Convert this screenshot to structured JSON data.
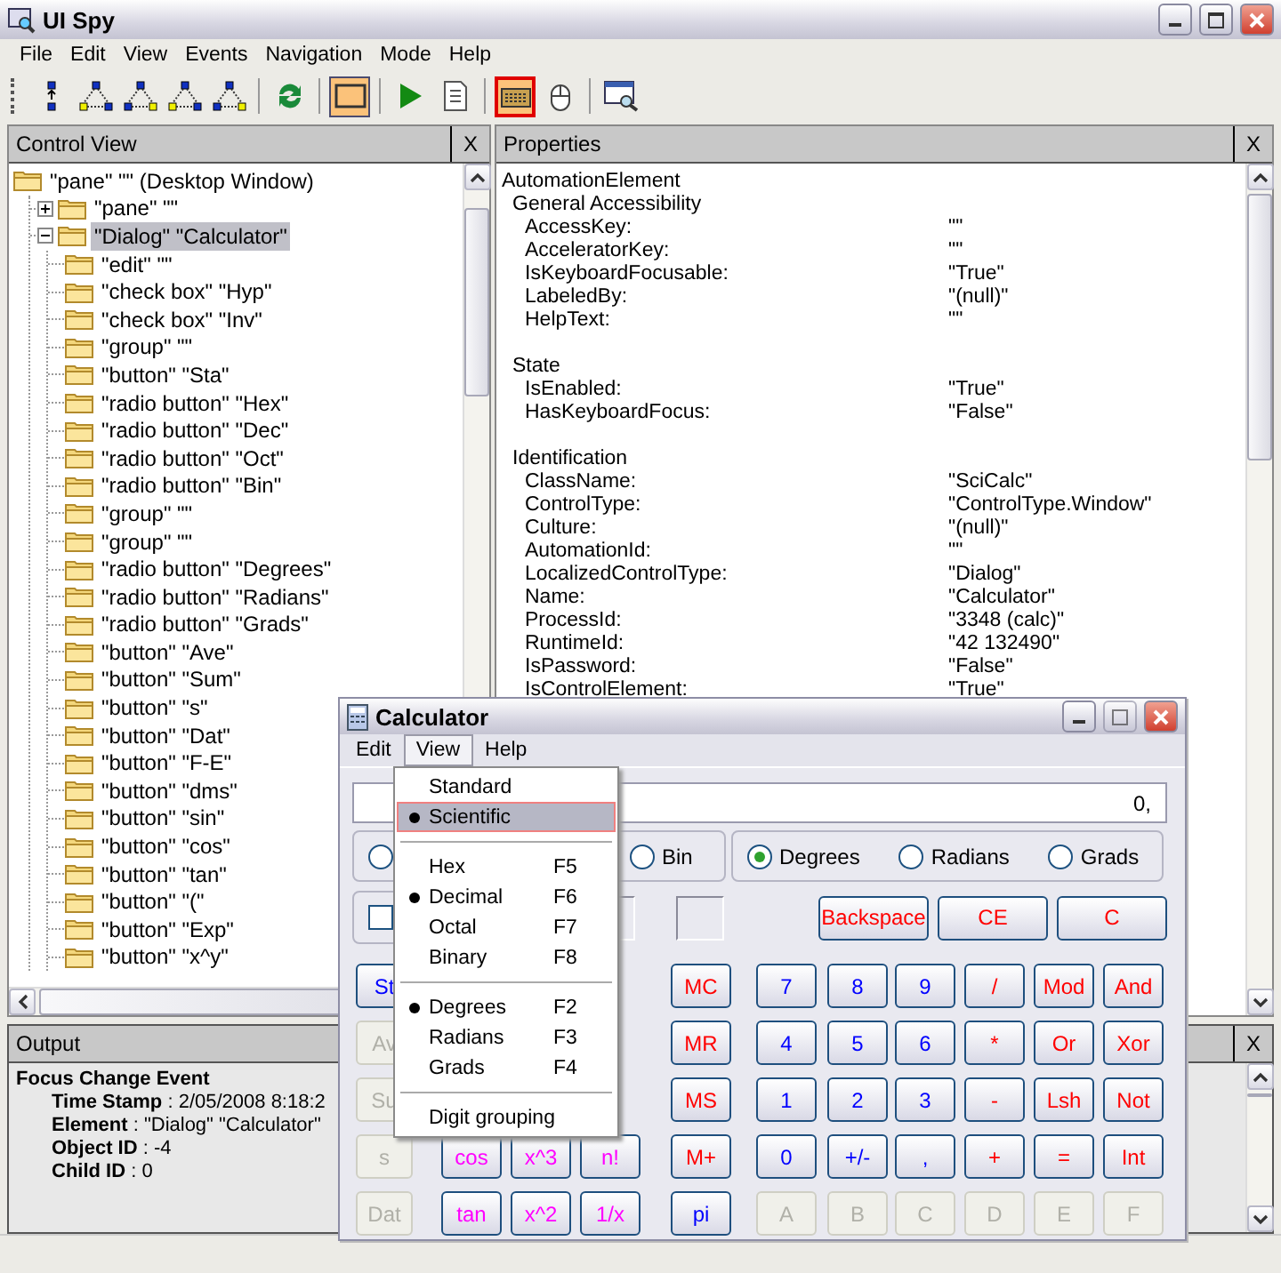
{
  "window": {
    "title": "UI Spy"
  },
  "menu": [
    {
      "label": "File"
    },
    {
      "label": "Edit"
    },
    {
      "label": "View"
    },
    {
      "label": "Events"
    },
    {
      "label": "Navigation"
    },
    {
      "label": "Mode"
    },
    {
      "label": "Help"
    }
  ],
  "toolbar": [
    {
      "kind": "parent",
      "pressed": false,
      "highlighted": false
    },
    {
      "kind": "first-child",
      "pressed": false,
      "highlighted": false
    },
    {
      "kind": "next-sibling",
      "pressed": false,
      "highlighted": false
    },
    {
      "kind": "previous-sibling",
      "pressed": false,
      "highlighted": false
    },
    {
      "kind": "last-child",
      "pressed": false,
      "highlighted": false
    },
    {
      "kind": "separator"
    },
    {
      "kind": "refresh",
      "pressed": false,
      "highlighted": false
    },
    {
      "kind": "separator"
    },
    {
      "kind": "highlight",
      "pressed": true,
      "highlighted": false
    },
    {
      "kind": "separator"
    },
    {
      "kind": "play",
      "pressed": false,
      "highlighted": false
    },
    {
      "kind": "list",
      "pressed": false,
      "highlighted": false
    },
    {
      "kind": "separator"
    },
    {
      "kind": "keyboard",
      "pressed": true,
      "highlighted": true
    },
    {
      "kind": "mouse",
      "pressed": false,
      "highlighted": false
    },
    {
      "kind": "separator"
    },
    {
      "kind": "inspect",
      "pressed": false,
      "highlighted": false
    }
  ],
  "control_view": {
    "title": "Control View",
    "close": "X",
    "tree": [
      {
        "label": "\"pane\" \"\" (Desktop Window)",
        "selected": false,
        "children": [
          {
            "label": "\"pane\" \"\"",
            "selected": false,
            "expanded": false
          },
          {
            "label": "\"Dialog\" \"Calculator\"",
            "selected": true,
            "expanded": true,
            "children": [
              {
                "label": "\"edit\" \"\"",
                "selected": false
              },
              {
                "label": "\"check box\" \"Hyp\"",
                "selected": false
              },
              {
                "label": "\"check box\" \"Inv\"",
                "selected": false
              },
              {
                "label": "\"group\" \"\"",
                "selected": false
              },
              {
                "label": "\"button\" \"Sta\"",
                "selected": false
              },
              {
                "label": "\"radio button\" \"Hex\"",
                "selected": false
              },
              {
                "label": "\"radio button\" \"Dec\"",
                "selected": false
              },
              {
                "label": "\"radio button\" \"Oct\"",
                "selected": false
              },
              {
                "label": "\"radio button\" \"Bin\"",
                "selected": false
              },
              {
                "label": "\"group\" \"\"",
                "selected": false
              },
              {
                "label": "\"group\" \"\"",
                "selected": false
              },
              {
                "label": "\"radio button\" \"Degrees\"",
                "selected": false
              },
              {
                "label": "\"radio button\" \"Radians\"",
                "selected": false
              },
              {
                "label": "\"radio button\" \"Grads\"",
                "selected": false
              },
              {
                "label": "\"button\" \"Ave\"",
                "selected": false
              },
              {
                "label": "\"button\" \"Sum\"",
                "selected": false
              },
              {
                "label": "\"button\" \"s\"",
                "selected": false
              },
              {
                "label": "\"button\" \"Dat\"",
                "selected": false
              },
              {
                "label": "\"button\" \"F-E\"",
                "selected": false
              },
              {
                "label": "\"button\" \"dms\"",
                "selected": false
              },
              {
                "label": "\"button\" \"sin\"",
                "selected": false
              },
              {
                "label": "\"button\" \"cos\"",
                "selected": false
              },
              {
                "label": "\"button\" \"tan\"",
                "selected": false
              },
              {
                "label": "\"button\" \"(\"",
                "selected": false
              },
              {
                "label": "\"button\" \"Exp\"",
                "selected": false
              },
              {
                "label": "\"button\" \"x^y\"",
                "selected": false
              }
            ]
          }
        ]
      }
    ]
  },
  "properties": {
    "title": "Properties",
    "close": "X",
    "root": "AutomationElement",
    "groups": [
      {
        "title": "General Accessibility",
        "rows": [
          {
            "name": "AccessKey:",
            "value": "\"\""
          },
          {
            "name": "AcceleratorKey:",
            "value": "\"\""
          },
          {
            "name": "IsKeyboardFocusable:",
            "value": "\"True\""
          },
          {
            "name": "LabeledBy:",
            "value": "\"(null)\""
          },
          {
            "name": "HelpText:",
            "value": "\"\""
          }
        ]
      },
      {
        "title": "State",
        "rows": [
          {
            "name": "IsEnabled:",
            "value": "\"True\""
          },
          {
            "name": "HasKeyboardFocus:",
            "value": "\"False\""
          }
        ]
      },
      {
        "title": "Identification",
        "rows": [
          {
            "name": "ClassName:",
            "value": "\"SciCalc\""
          },
          {
            "name": "ControlType:",
            "value": "\"ControlType.Window\""
          },
          {
            "name": "Culture:",
            "value": "\"(null)\""
          },
          {
            "name": "AutomationId:",
            "value": "\"\""
          },
          {
            "name": "LocalizedControlType:",
            "value": "\"Dialog\""
          },
          {
            "name": "Name:",
            "value": "\"Calculator\""
          },
          {
            "name": "ProcessId:",
            "value": "\"3348 (calc)\""
          },
          {
            "name": "RuntimeId:",
            "value": "\"42 132490\""
          },
          {
            "name": "IsPassword:",
            "value": "\"False\""
          },
          {
            "name": "IsControlElement:",
            "value": "\"True\""
          }
        ]
      }
    ]
  },
  "output": {
    "title": "Output",
    "close": "X",
    "event": "Focus Change Event",
    "lines": [
      "**Time Stamp** : 2/05/2008 8:18:2",
      "**Element** : \"Dialog\" \"Calculator\"",
      "**Object ID** : -4",
      "**Child ID** : 0"
    ]
  },
  "calculator": {
    "title": "Calculator",
    "menu": [
      {
        "label": "Edit",
        "selected": false
      },
      {
        "label": "View",
        "selected": true
      },
      {
        "label": "Help",
        "selected": false
      }
    ],
    "display": "0,",
    "base_radios": [
      {
        "selected": false
      },
      {
        "label": "Bin",
        "selected": false
      }
    ],
    "angle_radios": [
      {
        "label": "Degrees",
        "selected": true
      },
      {
        "label": "Radians",
        "selected": false
      },
      {
        "label": "Grads",
        "selected": false
      }
    ],
    "checkbox": {
      "checked": false
    },
    "edit_buttons": [
      {
        "label": "Backspace",
        "kind": "operator",
        "disabled": false
      },
      {
        "label": "CE",
        "kind": "operator",
        "disabled": false
      },
      {
        "label": "C",
        "kind": "operator",
        "disabled": false
      }
    ],
    "rows": [
      [
        {
          "label": "St",
          "kind": "stat",
          "disabled": false
        },
        null,
        null,
        null,
        {
          "label": "MC",
          "kind": "memory",
          "disabled": false
        },
        {
          "label": "7",
          "kind": "digit",
          "disabled": false
        },
        {
          "label": "8",
          "kind": "digit",
          "disabled": false
        },
        {
          "label": "9",
          "kind": "digit",
          "disabled": false
        },
        {
          "label": "/",
          "kind": "operator",
          "disabled": false
        },
        {
          "label": "Mod",
          "kind": "operator",
          "disabled": false
        },
        {
          "label": "And",
          "kind": "operator",
          "disabled": false
        }
      ],
      [
        {
          "label": "Av",
          "kind": "stat",
          "disabled": true
        },
        null,
        null,
        null,
        {
          "label": "MR",
          "kind": "memory",
          "disabled": false
        },
        {
          "label": "4",
          "kind": "digit",
          "disabled": false
        },
        {
          "label": "5",
          "kind": "digit",
          "disabled": false
        },
        {
          "label": "6",
          "kind": "digit",
          "disabled": false
        },
        {
          "label": "*",
          "kind": "operator",
          "disabled": false
        },
        {
          "label": "Or",
          "kind": "operator",
          "disabled": false
        },
        {
          "label": "Xor",
          "kind": "operator",
          "disabled": false
        }
      ],
      [
        {
          "label": "Su",
          "kind": "stat",
          "disabled": true
        },
        null,
        null,
        null,
        {
          "label": "MS",
          "kind": "memory",
          "disabled": false
        },
        {
          "label": "1",
          "kind": "digit",
          "disabled": false
        },
        {
          "label": "2",
          "kind": "digit",
          "disabled": false
        },
        {
          "label": "3",
          "kind": "digit",
          "disabled": false
        },
        {
          "label": "-",
          "kind": "operator",
          "disabled": false
        },
        {
          "label": "Lsh",
          "kind": "operator",
          "disabled": false
        },
        {
          "label": "Not",
          "kind": "operator",
          "disabled": false
        }
      ],
      [
        {
          "label": "s",
          "kind": "stat",
          "disabled": true
        },
        {
          "label": "cos",
          "kind": "function",
          "disabled": false
        },
        {
          "label": "x^3",
          "kind": "function",
          "disabled": false
        },
        {
          "label": "n!",
          "kind": "function",
          "disabled": false
        },
        {
          "label": "M+",
          "kind": "memory",
          "disabled": false
        },
        {
          "label": "0",
          "kind": "digit",
          "disabled": false
        },
        {
          "label": "+/-",
          "kind": "digit",
          "disabled": false
        },
        {
          "label": ",",
          "kind": "digit",
          "disabled": false
        },
        {
          "label": "+",
          "kind": "operator",
          "disabled": false
        },
        {
          "label": "=",
          "kind": "operator",
          "disabled": false
        },
        {
          "label": "Int",
          "kind": "operator",
          "disabled": false
        }
      ],
      [
        {
          "label": "Dat",
          "kind": "stat",
          "disabled": true
        },
        {
          "label": "tan",
          "kind": "function",
          "disabled": false
        },
        {
          "label": "x^2",
          "kind": "function",
          "disabled": false
        },
        {
          "label": "1/x",
          "kind": "function",
          "disabled": false
        },
        {
          "label": "pi",
          "kind": "digit",
          "disabled": false
        },
        {
          "label": "A",
          "kind": "digit",
          "disabled": true
        },
        {
          "label": "B",
          "kind": "digit",
          "disabled": true
        },
        {
          "label": "C",
          "kind": "digit",
          "disabled": true
        },
        {
          "label": "D",
          "kind": "digit",
          "disabled": true
        },
        {
          "label": "E",
          "kind": "digit",
          "disabled": true
        },
        {
          "label": "F",
          "kind": "digit",
          "disabled": true
        }
      ]
    ],
    "view_menu": [
      {
        "kind": "item",
        "label": "Standard",
        "checked": false,
        "selected": false
      },
      {
        "kind": "item",
        "label": "Scientific",
        "checked": true,
        "selected": true
      },
      {
        "kind": "separator"
      },
      {
        "kind": "item",
        "label": "Hex",
        "shortcut": "F5",
        "checked": false,
        "selected": false
      },
      {
        "kind": "item",
        "label": "Decimal",
        "shortcut": "F6",
        "checked": true,
        "selected": false
      },
      {
        "kind": "item",
        "label": "Octal",
        "shortcut": "F7",
        "checked": false,
        "selected": false
      },
      {
        "kind": "item",
        "label": "Binary",
        "shortcut": "F8",
        "checked": false,
        "selected": false
      },
      {
        "kind": "separator"
      },
      {
        "kind": "item",
        "label": "Degrees",
        "shortcut": "F2",
        "checked": true,
        "selected": false
      },
      {
        "kind": "item",
        "label": "Radians",
        "shortcut": "F3",
        "checked": false,
        "selected": false
      },
      {
        "kind": "item",
        "label": "Grads",
        "shortcut": "F4",
        "checked": false,
        "selected": false
      },
      {
        "kind": "separator"
      },
      {
        "kind": "item",
        "label": "Digit grouping",
        "checked": false,
        "selected": false
      }
    ]
  }
}
